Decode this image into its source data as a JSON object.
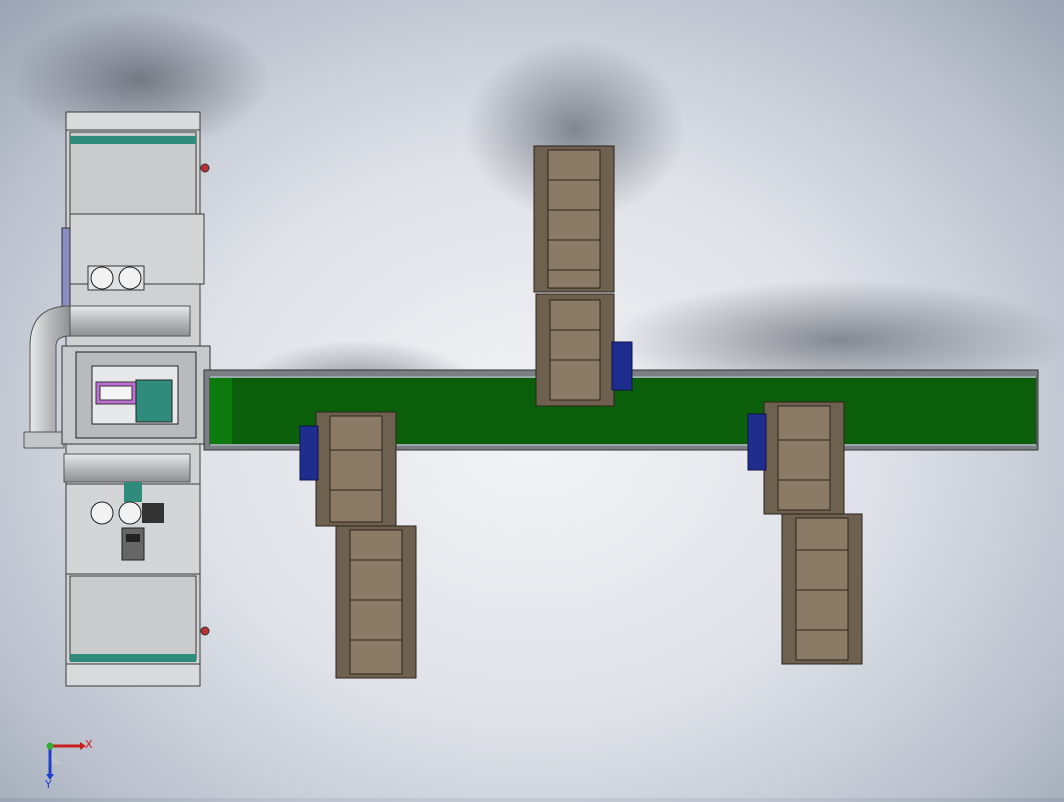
{
  "viewport": {
    "background": "#dfe2e8",
    "colors": {
      "belt_green": "#0b5f0b",
      "frame_gray": "#cfd1d3",
      "conveyor_brown": "#6f6150",
      "motor_blue": "#1f2d8f",
      "teal_strip": "#2f8c7d",
      "magenta_part": "#c06fd6"
    }
  },
  "triad": {
    "x_label": "X",
    "y_label": "Y",
    "x_color": "#c91f1f",
    "y_color": "#1f3fc9",
    "origin_color": "#2fae2f"
  }
}
